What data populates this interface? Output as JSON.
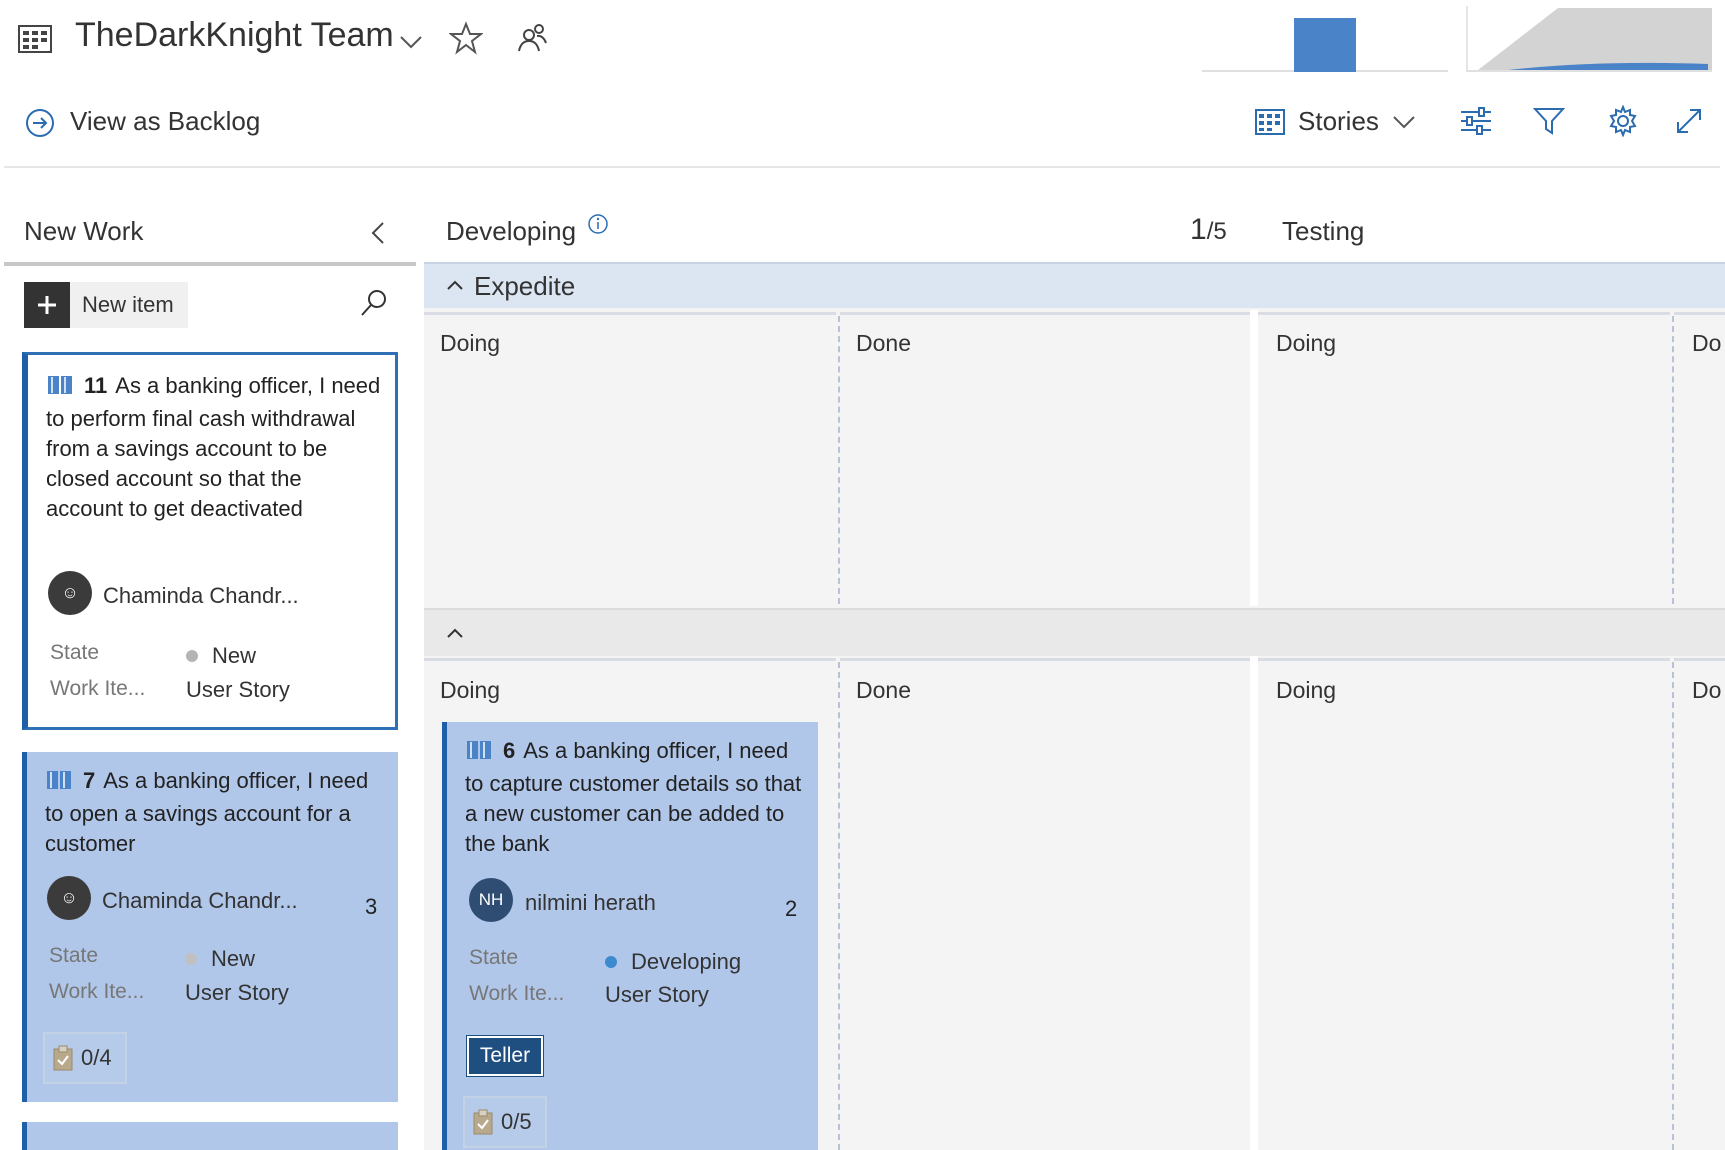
{
  "header": {
    "team_name": "TheDarkKnight Team",
    "view_backlog": "View as Backlog",
    "backlog_level": "Stories"
  },
  "columns": {
    "new_work": "New Work",
    "developing": "Developing",
    "wip_current": "1",
    "wip_limit": "/5",
    "testing": "Testing"
  },
  "new_work": {
    "new_item_label": "New item"
  },
  "lanes": {
    "expedite": "Expedite",
    "sub_doing": "Doing",
    "sub_done": "Done",
    "sub_do_partial": "Do"
  },
  "cards": [
    {
      "id": "11",
      "title": "As a banking officer, I need to perform final cash withdrawal from a savings account to be closed account so that the account to get deactivated",
      "assignee": "Chaminda Chandr...",
      "state_label": "State",
      "state": "New",
      "type_label": "Work Ite...",
      "type": "User Story"
    },
    {
      "id": "7",
      "title": "As a banking officer, I need to open a savings account for a customer",
      "assignee": "Chaminda Chandr...",
      "estimate": "3",
      "state_label": "State",
      "state": "New",
      "type_label": "Work Ite...",
      "type": "User Story",
      "tasks": "0/4"
    },
    {
      "id": "6",
      "title": "As a banking officer, I need to capture customer details so that a new customer can be added to the bank",
      "assignee": "nilmini herath",
      "assignee_initials": "NH",
      "estimate": "2",
      "state_label": "State",
      "state": "Developing",
      "type_label": "Work Ite...",
      "type": "User Story",
      "tag": "Teller",
      "tasks": "0/5"
    }
  ],
  "colors": {
    "card_blue": "#b1c7ea",
    "card_border": "#1e5fa8",
    "state_new": "#b4b4b4",
    "state_developing": "#3c8ad0",
    "tag_bg": "#1f4f80",
    "chart_fill": "#4a83c8"
  },
  "icons": {
    "board": "board-icon",
    "chevron": "chevron-down-icon",
    "favorite": "star-icon",
    "team": "team-members-icon",
    "backlog": "arrow-circle-icon",
    "settings": "gear-icon",
    "filter": "filter-icon",
    "options": "sliders-icon",
    "fullscreen": "expand-icon",
    "search": "search-icon",
    "add": "plus-icon",
    "info": "info-icon"
  }
}
